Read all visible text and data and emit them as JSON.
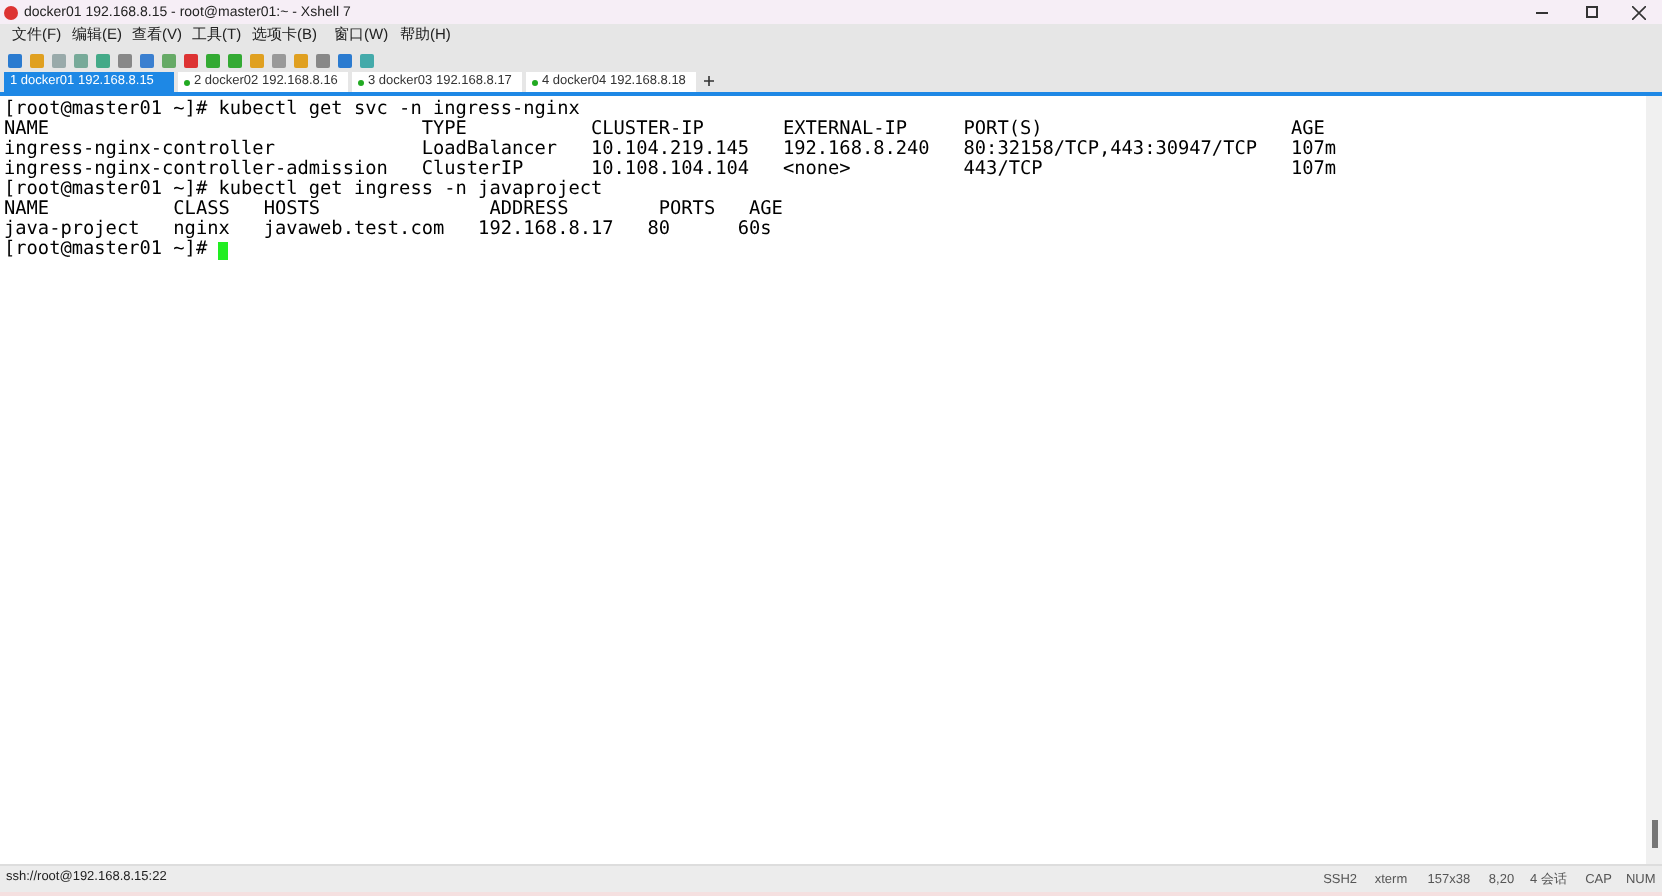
{
  "window": {
    "title": "docker01 192.168.8.15 - root@master01:~ - Xshell 7"
  },
  "menu": [
    "文件(F)",
    "编辑(E)",
    "查看(V)",
    "工具(T)",
    "选项卡(B)",
    "窗口(W)",
    "帮助(H)"
  ],
  "tabs": [
    {
      "label": "1 docker01 192.168.8.15",
      "selected": true
    },
    {
      "label": "2 docker02 192.168.8.16",
      "selected": false
    },
    {
      "label": "3 docker03 192.168.8.17",
      "selected": false
    },
    {
      "label": "4 docker04 192.168.8.18",
      "selected": false
    }
  ],
  "terminal": {
    "lines": [
      "[root@master01 ~]# kubectl get svc -n ingress-nginx",
      "NAME                                 TYPE           CLUSTER-IP       EXTERNAL-IP     PORT(S)                      AGE",
      "ingress-nginx-controller             LoadBalancer   10.104.219.145   192.168.8.240   80:32158/TCP,443:30947/TCP   107m",
      "ingress-nginx-controller-admission   ClusterIP      10.108.104.104   <none>          443/TCP                      107m",
      "[root@master01 ~]# kubectl get ingress -n javaproject",
      "NAME           CLASS   HOSTS               ADDRESS        PORTS   AGE",
      "java-project   nginx   javaweb.test.com   192.168.8.17   80      60s",
      "[root@master01 ~]# "
    ]
  },
  "status_bar": {
    "address": "ssh://root@192.168.8.15:22",
    "items": [
      "SSH2",
      "xterm",
      "157x38",
      "8,20",
      "4 会话",
      "CAP",
      "NUM"
    ]
  }
}
